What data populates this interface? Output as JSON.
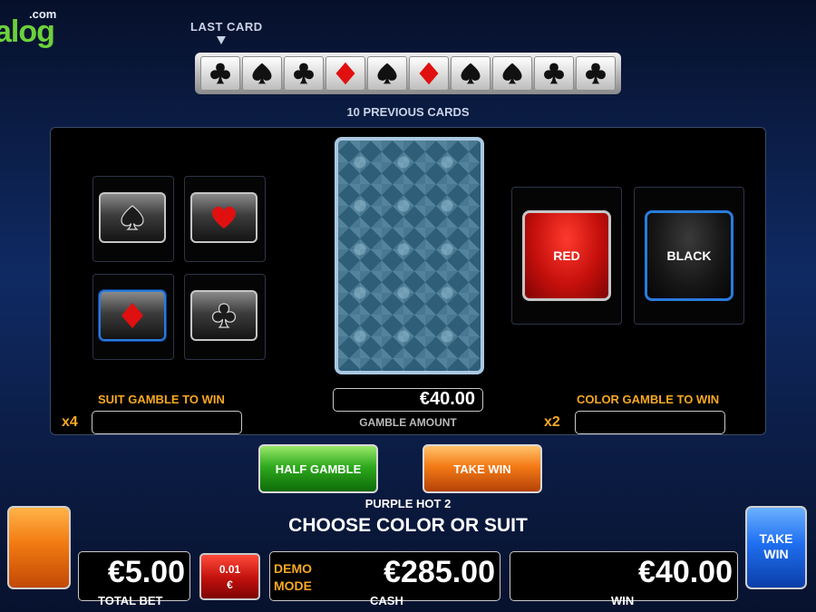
{
  "logo": {
    "suffix": ".com",
    "text": "alog"
  },
  "history": {
    "last_card_label": "LAST CARD",
    "previous_label": "10 PREVIOUS CARDS",
    "cards": [
      "club",
      "spade",
      "club",
      "diamond",
      "spade",
      "diamond",
      "spade",
      "spade",
      "club",
      "club"
    ]
  },
  "suits": [
    {
      "suit": "spade",
      "selected": false
    },
    {
      "suit": "heart",
      "selected": false
    },
    {
      "suit": "diamond",
      "selected": true
    },
    {
      "suit": "club",
      "selected": false
    }
  ],
  "colors": {
    "red": "RED",
    "black": "BLACK"
  },
  "suit_gamble": {
    "label": "SUIT GAMBLE TO WIN",
    "multiplier": "x4",
    "value": ""
  },
  "color_gamble": {
    "label": "COLOR GAMBLE TO WIN",
    "multiplier": "x2",
    "value": ""
  },
  "gamble": {
    "amount": "€40.00",
    "label": "GAMBLE AMOUNT"
  },
  "buttons": {
    "half_gamble": "HALF GAMBLE",
    "take_win": "TAKE WIN",
    "take_win_side_line1": "TAKE",
    "take_win_side_line2": "WIN"
  },
  "game": {
    "name": "PURPLE HOT 2",
    "prompt": "CHOOSE COLOR OR SUIT"
  },
  "footer": {
    "total_bet_value": "€5.00",
    "total_bet_label": "TOTAL BET",
    "denom_line1": "0.01",
    "denom_line2": "€",
    "demo_line1": "DEMO",
    "demo_line2": "MODE",
    "cash_value": "€285.00",
    "cash_label": "CASH",
    "win_value": "€40.00",
    "win_label": "WIN"
  },
  "theme": {
    "red_suit": "#e01010",
    "black_suit": "#111111",
    "accent_orange": "#f7a823",
    "selected_blue": "#2a7bdc"
  }
}
